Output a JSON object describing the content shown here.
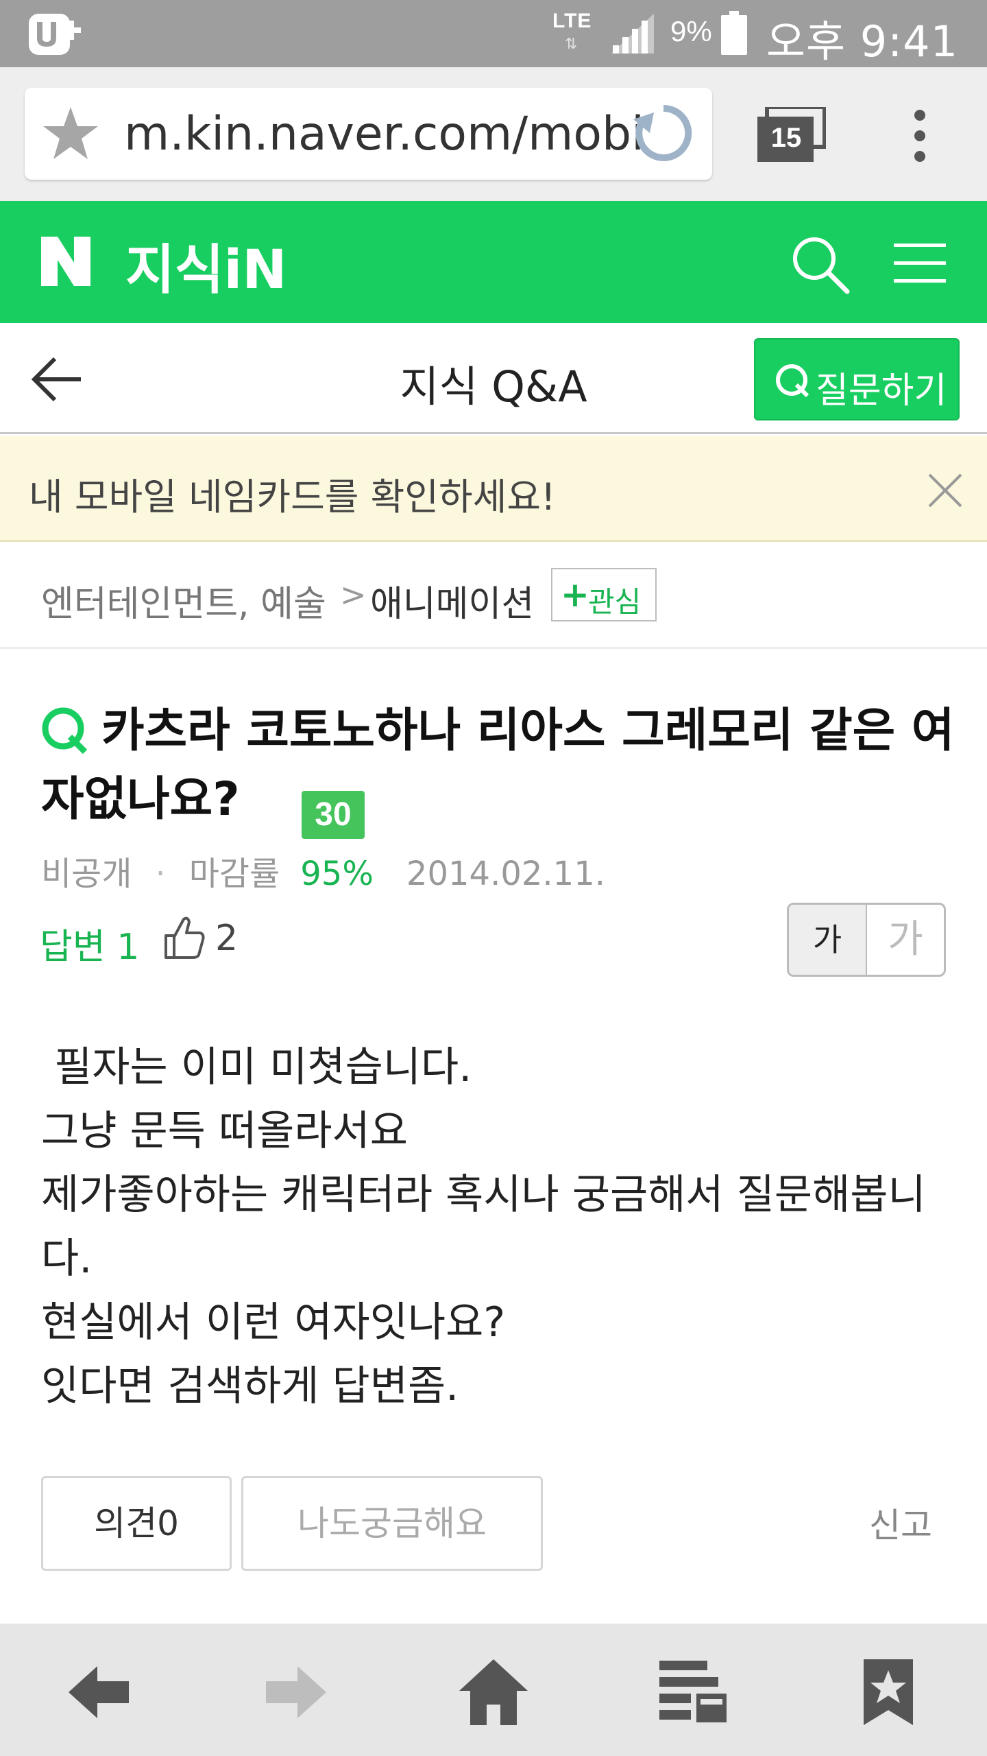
{
  "status_bar": {
    "network": "LTE",
    "battery": "9%",
    "time": "오후 9:41"
  },
  "browser": {
    "url": "m.kin.naver.com/mobile/qna/detail.nhn",
    "tab_count": "15"
  },
  "header": {
    "logo": "N",
    "service": "지식iN"
  },
  "subheader": {
    "title": "지식 Q&A",
    "ask_label": "질문하기"
  },
  "banner": {
    "text": "내 모바일 네임카드를 확인하세요!"
  },
  "breadcrumb": {
    "parent": "엔터테인먼트, 예술",
    "separator": ">",
    "current": "애니메이션",
    "follow_plus": "+",
    "follow_label": "관심"
  },
  "question": {
    "title": "카츠라 코토노하나 리아스 그레모리 같은 여자없나요?",
    "points": "30",
    "author": "비공개",
    "rate_label": "마감률",
    "rate_value": "95%",
    "date": "2014.02.11.",
    "answers": "답변 1",
    "likes": "2",
    "font_small": "가",
    "font_large": "가",
    "body": " 필자는 이미 미쳣습니다.\n그냥 문득 떠올라서요\n제가좋아하는 캐릭터라 혹시나 궁금해서 질문해봅니다.\n현실에서 이런 여자잇나요?\n잇다면 검색하게 답변좀."
  },
  "actions": {
    "comment": "의견0",
    "curious": "나도궁금해요",
    "report": "신고"
  },
  "colors": {
    "naver_green": "#19ce60",
    "status_bar": "#9e9e9e",
    "banner_bg": "#fbf8de"
  }
}
